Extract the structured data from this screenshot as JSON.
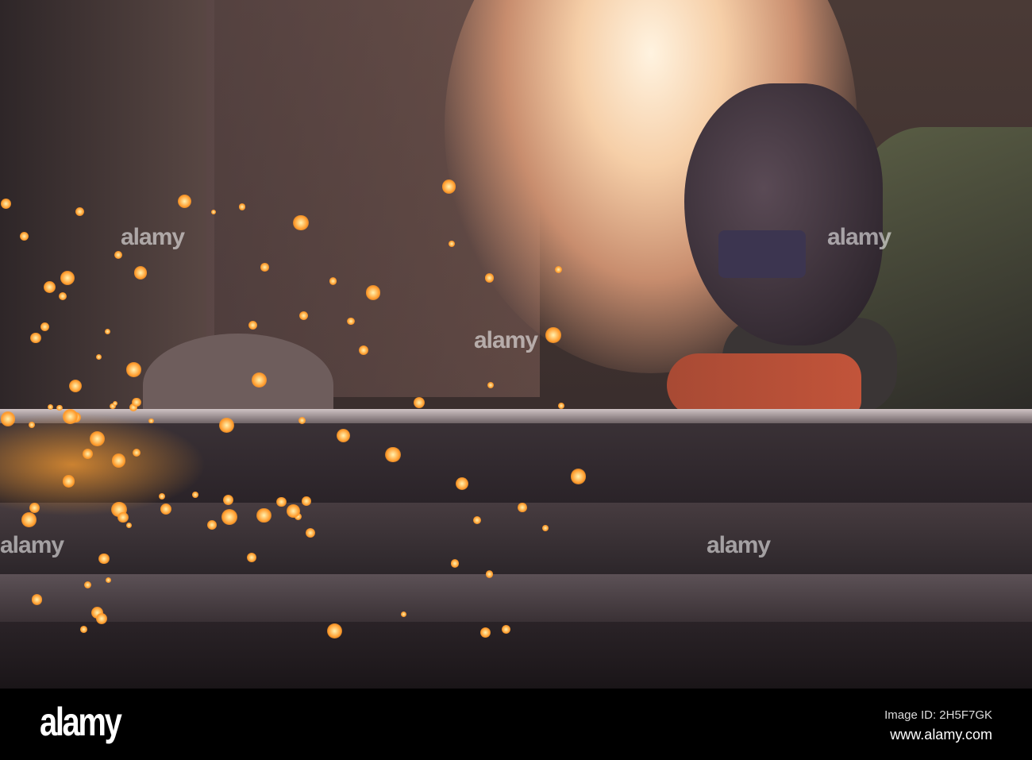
{
  "watermark": {
    "text": "alamy"
  },
  "footer": {
    "logo": "alamy",
    "image_id": "Image ID: 2H5F7GK",
    "url": "www.alamy.com"
  },
  "colors": {
    "spark": "#ff9a2a",
    "glove": "#c2543a",
    "backlight": "#f6cfa8"
  }
}
